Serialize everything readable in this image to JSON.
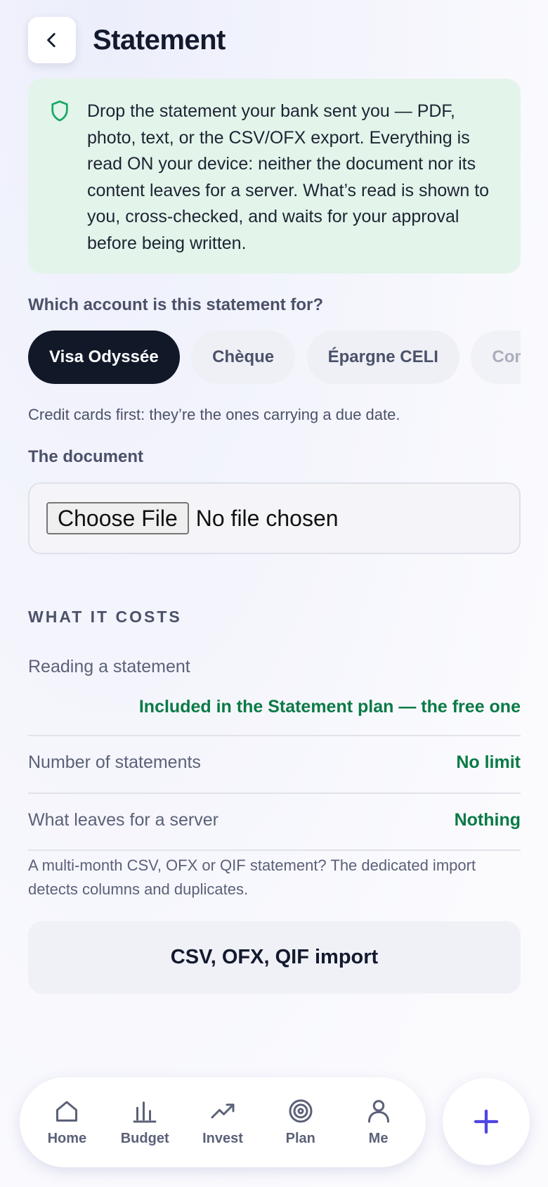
{
  "header": {
    "title": "Statement"
  },
  "notice": {
    "text": "Drop the statement your bank sent you — PDF, photo, text, or the CSV/OFX export. Everything is read ON your device: neither the document nor its content leaves for a server. What’s read is shown to you, cross-checked, and waits for your approval before being written."
  },
  "account": {
    "question": "Which account is this statement for?",
    "chips": [
      "Visa Odyssée",
      "Chèque",
      "Épargne CELI",
      "Compte US"
    ],
    "selected": "Visa Odyssée",
    "hint": "Credit cards first: they’re the ones carrying a due date."
  },
  "document": {
    "label": "The document",
    "button": "Choose File",
    "status": "No file chosen"
  },
  "costs": {
    "title": "WHAT IT COSTS",
    "rows": [
      {
        "label": "Reading a statement",
        "value": "Included in the Statement plan — the free one"
      },
      {
        "label": "Number of statements",
        "value": "No limit"
      },
      {
        "label": "What leaves for a server",
        "value": "Nothing"
      }
    ]
  },
  "import": {
    "note": "A multi-month CSV, OFX or QIF statement? The dedicated import detects columns and duplicates.",
    "button": "CSV, OFX, QIF import"
  },
  "nav": {
    "items": [
      {
        "label": "Home",
        "icon": "home-icon"
      },
      {
        "label": "Budget",
        "icon": "bar-chart-icon"
      },
      {
        "label": "Invest",
        "icon": "trending-up-icon"
      },
      {
        "label": "Plan",
        "icon": "target-icon"
      },
      {
        "label": "Me",
        "icon": "user-icon"
      }
    ],
    "fab_icon": "plus-icon"
  },
  "colors": {
    "accent": "#4f46e5",
    "success": "#0a7a45",
    "notice_bg": "#e3f4ea",
    "dark_chip": "#111827"
  }
}
